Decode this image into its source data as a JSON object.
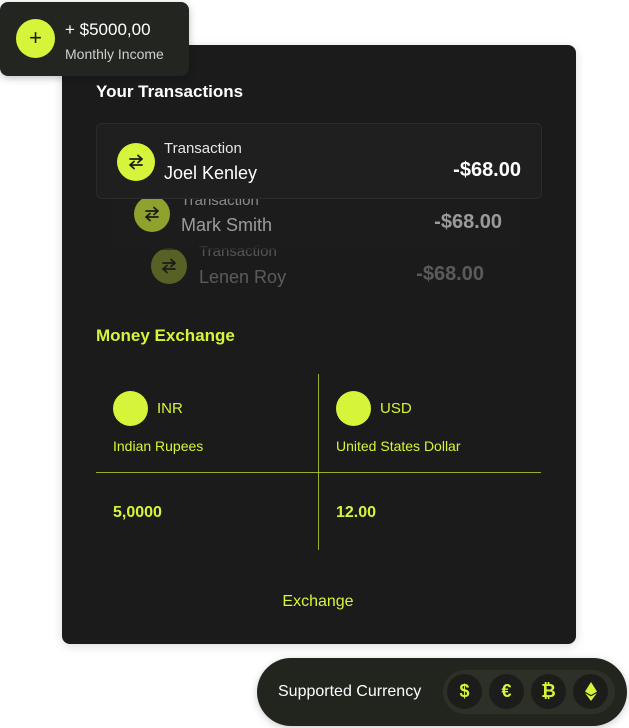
{
  "colors": {
    "accent": "#d6f53a",
    "card_background": "#1b1b1b",
    "badge_background": "#232620"
  },
  "income": {
    "icon": "plus-icon",
    "icon_glyph": "+",
    "amount": "+ $5000,00",
    "label": "Monthly Income"
  },
  "transactions": {
    "title": "Your Transactions",
    "icon": "swap-arrows-icon",
    "items": [
      {
        "label": "Transaction",
        "name": "Joel Kenley",
        "amount": "-$68.00"
      },
      {
        "label": "Transaction",
        "name": "Mark Smith",
        "amount": "-$68.00"
      },
      {
        "label": "Transaction",
        "name": "Lenen Roy",
        "amount": "-$68.00"
      }
    ]
  },
  "exchange": {
    "title": "Money Exchange",
    "from": {
      "code": "INR",
      "name": "Indian Rupees",
      "value": "5,0000"
    },
    "to": {
      "code": "USD",
      "name": "United States Dollar",
      "value": "12.00"
    },
    "button_label": "Exchange"
  },
  "supported": {
    "label": "Supported Currency",
    "coins": [
      {
        "icon": "dollar-icon",
        "glyph": "$"
      },
      {
        "icon": "euro-icon",
        "glyph": "€"
      },
      {
        "icon": "bitcoin-icon",
        "glyph": "₿"
      },
      {
        "icon": "ethereum-icon",
        "glyph": ""
      }
    ]
  }
}
